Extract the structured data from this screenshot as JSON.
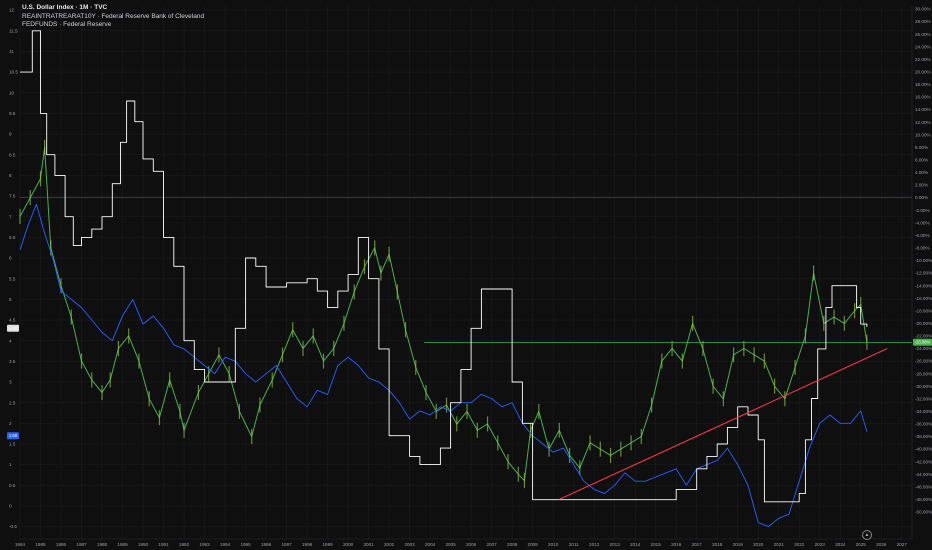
{
  "header": {
    "title": "U.S. Dollar Index · 1M · TVC",
    "line2": "REAINTRATREARAT10Y · Federal Reserve Bank of Cleveland",
    "line3": "FEDFUNDS · Federal Reserve"
  },
  "colors": {
    "background": "#0f0f0f",
    "grid": "#1e1f22",
    "price": "#4caf50",
    "white_line": "#ffffff",
    "blue_line": "#2962ff",
    "trendline": "#f23645",
    "hline": "#4caf50"
  },
  "icon": "tradingview-logo-icon",
  "chart_data": {
    "type": "line",
    "title": "U.S. Dollar Index · 1M · TVC",
    "x_ticks": [
      "1984",
      "1985",
      "1986",
      "1987",
      "1988",
      "1989",
      "1990",
      "1991",
      "1992",
      "1993",
      "1994",
      "1995",
      "1996",
      "1997",
      "1998",
      "1999",
      "2000",
      "2001",
      "2002",
      "2003",
      "2004",
      "2005",
      "2006",
      "2007",
      "2008",
      "2009",
      "2010",
      "2011",
      "2012",
      "2013",
      "2014",
      "2015",
      "2016",
      "2017",
      "2018",
      "2019",
      "2020",
      "2021",
      "2022",
      "2023",
      "2024",
      "2025",
      "2026",
      "2027"
    ],
    "xlim": [
      1984,
      2027.5
    ],
    "left_axis": {
      "ticks": [
        "12",
        "11.5",
        "11",
        "10.5",
        "10",
        "9.5",
        "9",
        "8.5",
        "8",
        "7.5",
        "7",
        "6.5",
        "6",
        "5.5",
        "5",
        "4.5",
        "4",
        "3.5",
        "3",
        "2.5",
        "2",
        "1.5",
        "1",
        "0.5",
        "0",
        "-0.5"
      ],
      "ylim": [
        -0.8,
        12.1
      ],
      "badges": [
        {
          "value": 4.3,
          "label": "4.33"
        },
        {
          "value": 1.7,
          "label": "1.68"
        }
      ]
    },
    "right_axis": {
      "ticks": [
        "30.00%",
        "28.00%",
        "26.00%",
        "24.00%",
        "22.00%",
        "20.00%",
        "18.00%",
        "16.00%",
        "14.00%",
        "12.00%",
        "10.00%",
        "8.00%",
        "6.00%",
        "4.00%",
        "2.00%",
        "0.00%",
        "-2.00%",
        "-4.00%",
        "-6.00%",
        "-8.00%",
        "-10.00%",
        "-12.00%",
        "-14.00%",
        "-16.00%",
        "-18.00%",
        "-20.00%",
        "-22.00%",
        "-24.00%",
        "-26.00%",
        "-28.00%",
        "-30.00%",
        "-32.00%",
        "-34.00%",
        "-36.00%",
        "-38.00%",
        "-40.00%",
        "-42.00%",
        "-44.00%",
        "-46.00%",
        "-48.00%",
        "-50.00%"
      ],
      "badge": {
        "value": -23.0,
        "label": "-23.06%"
      }
    },
    "series": [
      {
        "id": "dxy",
        "axis": "right",
        "x": [
          1984.0,
          1984.5,
          1985.0,
          1985.2,
          1985.5,
          1986.0,
          1986.5,
          1987.0,
          1987.5,
          1988.0,
          1988.4,
          1988.8,
          1989.3,
          1989.8,
          1990.3,
          1990.8,
          1991.3,
          1991.8,
          1992.0,
          1992.7,
          1993.2,
          1993.7,
          1994.2,
          1994.7,
          1995.3,
          1995.7,
          1996.3,
          1996.8,
          1997.3,
          1997.8,
          1998.3,
          1998.8,
          1999.3,
          1999.8,
          2000.3,
          2000.8,
          2001.3,
          2001.6,
          2002.0,
          2002.4,
          2002.8,
          2003.3,
          2003.8,
          2004.3,
          2004.8,
          2005.3,
          2005.8,
          2006.3,
          2006.8,
          2007.3,
          2007.8,
          2008.3,
          2008.6,
          2008.9,
          2009.3,
          2009.8,
          2010.3,
          2010.8,
          2011.3,
          2011.8,
          2012.3,
          2012.8,
          2013.3,
          2013.8,
          2014.3,
          2014.8,
          2015.3,
          2015.8,
          2016.3,
          2016.8,
          2017.3,
          2017.8,
          2018.3,
          2018.8,
          2019.3,
          2019.8,
          2020.3,
          2020.8,
          2021.3,
          2021.8,
          2022.3,
          2022.7,
          2023.2,
          2023.7,
          2024.2,
          2024.7,
          2025.0,
          2025.3
        ],
        "y": [
          -3.0,
          0.0,
          3.0,
          8.0,
          -8.0,
          -14.0,
          -19.0,
          -26.0,
          -29.0,
          -31.0,
          -29.0,
          -24.0,
          -22.0,
          -26.0,
          -32.0,
          -35.0,
          -29.0,
          -34.0,
          -37.0,
          -31.0,
          -28.0,
          -25.0,
          -28.0,
          -34.0,
          -38.0,
          -33.0,
          -29.0,
          -25.0,
          -21.0,
          -24.0,
          -22.0,
          -26.0,
          -24.0,
          -20.0,
          -15.0,
          -11.0,
          -8.0,
          -12.0,
          -9.0,
          -15.0,
          -21.0,
          -27.0,
          -31.0,
          -34.0,
          -33.0,
          -36.0,
          -34.0,
          -37.0,
          -36.0,
          -39.0,
          -42.0,
          -44.0,
          -45.0,
          -37.0,
          -34.0,
          -40.0,
          -37.0,
          -41.0,
          -43.0,
          -39.0,
          -40.0,
          -41.0,
          -40.0,
          -39.0,
          -38.0,
          -33.0,
          -26.0,
          -24.0,
          -26.0,
          -20.0,
          -24.0,
          -30.0,
          -32.0,
          -25.0,
          -24.0,
          -25.0,
          -26.0,
          -30.0,
          -32.0,
          -27.0,
          -22.0,
          -12.0,
          -20.0,
          -19.0,
          -20.0,
          -18.0,
          -17.0,
          -23.0
        ]
      },
      {
        "id": "real_rate",
        "axis": "left",
        "x": [
          1984.0,
          1984.4,
          1984.8,
          1985.2,
          1985.6,
          1986.0,
          1986.5,
          1987.0,
          1987.5,
          1988.0,
          1988.5,
          1989.0,
          1989.5,
          1990.0,
          1990.5,
          1991.0,
          1991.5,
          1992.0,
          1992.5,
          1993.0,
          1993.5,
          1994.0,
          1994.5,
          1995.0,
          1995.5,
          1996.0,
          1996.5,
          1997.0,
          1997.5,
          1998.0,
          1998.5,
          1999.0,
          1999.5,
          2000.0,
          2000.5,
          2001.0,
          2001.5,
          2002.0,
          2002.5,
          2003.0,
          2003.5,
          2004.0,
          2004.5,
          2005.0,
          2005.5,
          2006.0,
          2006.5,
          2007.0,
          2007.5,
          2008.0,
          2008.5,
          2009.0,
          2009.5,
          2010.0,
          2010.5,
          2011.0,
          2011.5,
          2012.0,
          2012.5,
          2013.0,
          2013.5,
          2014.0,
          2014.5,
          2015.0,
          2015.5,
          2016.0,
          2016.5,
          2017.0,
          2017.5,
          2018.0,
          2018.5,
          2019.0,
          2019.5,
          2020.0,
          2020.5,
          2021.0,
          2021.5,
          2022.0,
          2022.5,
          2023.0,
          2023.5,
          2024.0,
          2024.5,
          2025.0,
          2025.3
        ],
        "y": [
          6.2,
          6.8,
          7.3,
          6.6,
          6.0,
          5.2,
          5.0,
          4.8,
          4.5,
          4.2,
          4.0,
          4.6,
          5.0,
          4.4,
          4.6,
          4.3,
          3.9,
          3.8,
          3.6,
          3.4,
          3.2,
          3.6,
          3.5,
          3.2,
          3.0,
          3.2,
          3.4,
          3.0,
          2.6,
          2.4,
          2.8,
          2.7,
          3.4,
          3.6,
          3.4,
          3.1,
          3.0,
          2.8,
          2.5,
          2.1,
          2.3,
          2.2,
          2.4,
          2.3,
          2.5,
          2.5,
          2.7,
          2.6,
          2.4,
          2.5,
          2.0,
          1.7,
          1.5,
          1.3,
          1.4,
          1.0,
          0.6,
          0.4,
          0.3,
          0.5,
          0.8,
          0.6,
          0.6,
          0.7,
          0.8,
          0.9,
          0.5,
          0.9,
          1.0,
          1.1,
          1.4,
          1.0,
          0.5,
          -0.4,
          -0.5,
          -0.3,
          -0.2,
          0.6,
          1.4,
          2.0,
          2.2,
          2.0,
          2.0,
          2.3,
          1.8
        ]
      },
      {
        "id": "fedfunds",
        "axis": "left",
        "x": [
          1984.0,
          1984.6,
          1985.0,
          1985.3,
          1985.7,
          1986.2,
          1986.6,
          1987.0,
          1987.5,
          1988.0,
          1988.5,
          1988.9,
          1989.2,
          1989.6,
          1990.0,
          1990.5,
          1991.0,
          1991.5,
          1992.0,
          1992.5,
          1993.0,
          1994.0,
          1994.5,
          1995.0,
          1995.5,
          1996.0,
          1997.0,
          1998.0,
          1998.5,
          1999.0,
          1999.5,
          2000.0,
          2000.5,
          2001.0,
          2001.5,
          2002.0,
          2003.0,
          2003.5,
          2004.0,
          2004.5,
          2005.0,
          2005.5,
          2006.0,
          2006.5,
          2007.5,
          2008.0,
          2008.5,
          2009.0,
          2012.0,
          2015.5,
          2016.0,
          2016.5,
          2017.0,
          2017.5,
          2018.0,
          2018.5,
          2019.0,
          2019.5,
          2020.0,
          2020.3,
          2021.5,
          2022.0,
          2022.3,
          2022.6,
          2022.9,
          2023.3,
          2023.6,
          2024.5,
          2024.8,
          2025.0,
          2025.3
        ],
        "y": [
          10.5,
          11.5,
          9.5,
          8.5,
          8.0,
          7.0,
          6.3,
          6.5,
          6.7,
          7.0,
          7.8,
          8.8,
          9.8,
          9.3,
          8.4,
          8.1,
          6.5,
          5.8,
          4.0,
          3.3,
          3.0,
          3.0,
          4.3,
          6.0,
          5.8,
          5.3,
          5.4,
          5.5,
          5.2,
          4.8,
          5.2,
          5.6,
          6.5,
          5.5,
          3.8,
          1.7,
          1.2,
          1.0,
          1.0,
          1.4,
          2.5,
          3.3,
          4.3,
          5.25,
          5.25,
          3.0,
          2.0,
          0.15,
          0.15,
          0.15,
          0.4,
          0.4,
          0.9,
          1.2,
          1.5,
          1.9,
          2.4,
          2.2,
          1.6,
          0.1,
          0.1,
          0.3,
          1.6,
          2.6,
          3.8,
          4.8,
          5.33,
          5.33,
          4.8,
          4.4,
          4.33
        ]
      }
    ],
    "annotations": [
      {
        "type": "horizontal_line",
        "axis": "right",
        "value": -23.06,
        "from_x": 2003.7
      },
      {
        "type": "trendline",
        "axis": "right",
        "from": [
          2010.3,
          -48.0
        ],
        "to": [
          2026.3,
          -24.0
        ]
      }
    ]
  }
}
